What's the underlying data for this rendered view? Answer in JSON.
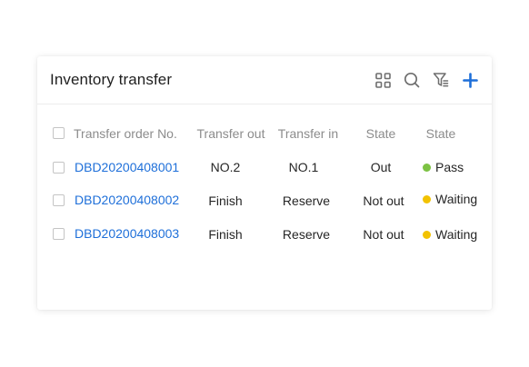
{
  "panel": {
    "title": "Inventory transfer"
  },
  "toolbar": {
    "icons": [
      "grid-icon",
      "search-icon",
      "filter-icon",
      "add-icon"
    ],
    "accent_color": "#1e6fd9"
  },
  "table": {
    "columns": [
      "Transfer order No.",
      "Transfer out",
      "Transfer in",
      "State",
      "State"
    ],
    "rows": [
      {
        "order_no": "DBD20200408001",
        "transfer_out": "NO.2",
        "transfer_in": "NO.1",
        "state": "Out",
        "status": "Pass",
        "status_color": "#7cc243"
      },
      {
        "order_no": "DBD20200408002",
        "transfer_out": "Finish",
        "transfer_in": "Reserve",
        "state": "Not out",
        "status": "Waiting",
        "status_color": "#f2c200"
      },
      {
        "order_no": "DBD20200408003",
        "transfer_out": "Finish",
        "transfer_in": "Reserve",
        "state": "Not out",
        "status": "Waiting",
        "status_color": "#f2c200"
      }
    ]
  }
}
